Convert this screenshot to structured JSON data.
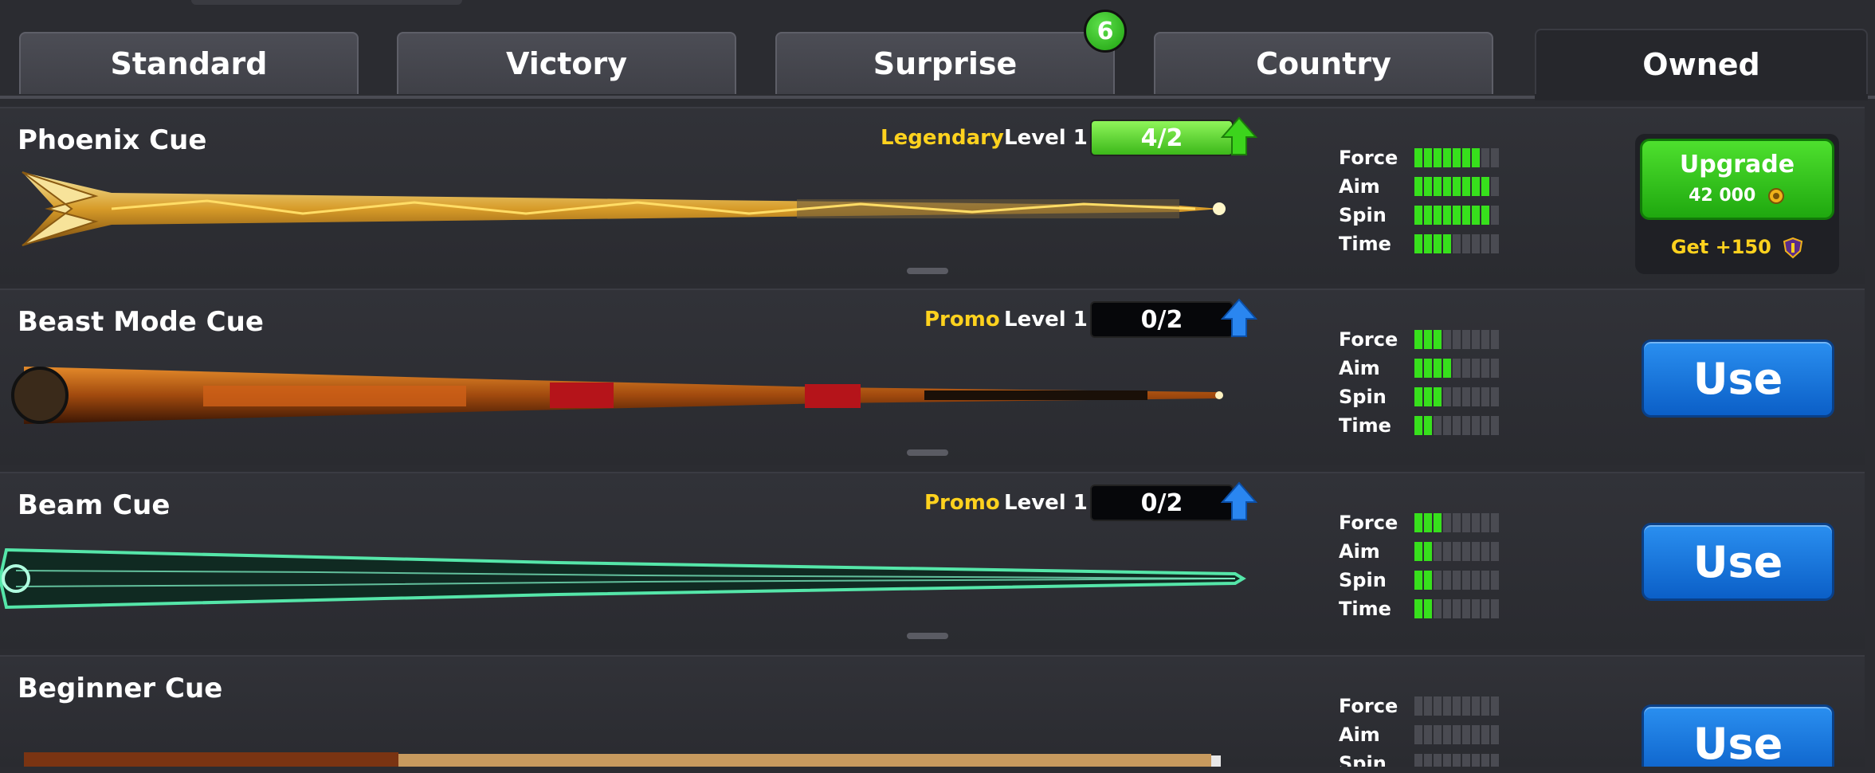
{
  "tabs": [
    {
      "label": "Standard"
    },
    {
      "label": "Victory"
    },
    {
      "label": "Surprise",
      "badge": "6"
    },
    {
      "label": "Country"
    },
    {
      "label": "Owned"
    }
  ],
  "active_tab": "Owned",
  "stat_labels": {
    "force": "Force",
    "aim": "Aim",
    "spin": "Spin",
    "time": "Time"
  },
  "cues": [
    {
      "name": "Phoenix Cue",
      "rarity": "Legendary",
      "level": "Level 1",
      "progress": "4/2",
      "progress_fraction": 1.0,
      "stats": {
        "force": 7,
        "aim": 8,
        "spin": 8,
        "time": 4
      },
      "action": {
        "label": "Upgrade",
        "price": "42 000",
        "bonus": "Get +150"
      },
      "arrow_color": "#3cd41c"
    },
    {
      "name": "Beast Mode Cue",
      "rarity": "Promo",
      "level": "Level 1",
      "progress": "0/2",
      "progress_fraction": 0,
      "stats": {
        "force": 3,
        "aim": 4,
        "spin": 3,
        "time": 2
      },
      "action": {
        "label": "Use"
      },
      "arrow_color": "#2a86f0"
    },
    {
      "name": "Beam Cue",
      "rarity": "Promo",
      "level": "Level 1",
      "progress": "0/2",
      "progress_fraction": 0,
      "stats": {
        "force": 3,
        "aim": 2,
        "spin": 2,
        "time": 2
      },
      "action": {
        "label": "Use"
      },
      "arrow_color": "#2a86f0"
    },
    {
      "name": "Beginner Cue",
      "stats": {
        "force": 0,
        "aim": 0,
        "spin": 0,
        "time": 0
      },
      "action": {
        "label": "Use"
      }
    }
  ],
  "stat_max": 9,
  "colors": {
    "background": "#2b2c31",
    "rarity": "#ffd21e",
    "stat_on": "#37e01c",
    "use_button": "#1a75de",
    "upgrade_button": "#3cc91f",
    "badge": "#2ebd1a"
  }
}
